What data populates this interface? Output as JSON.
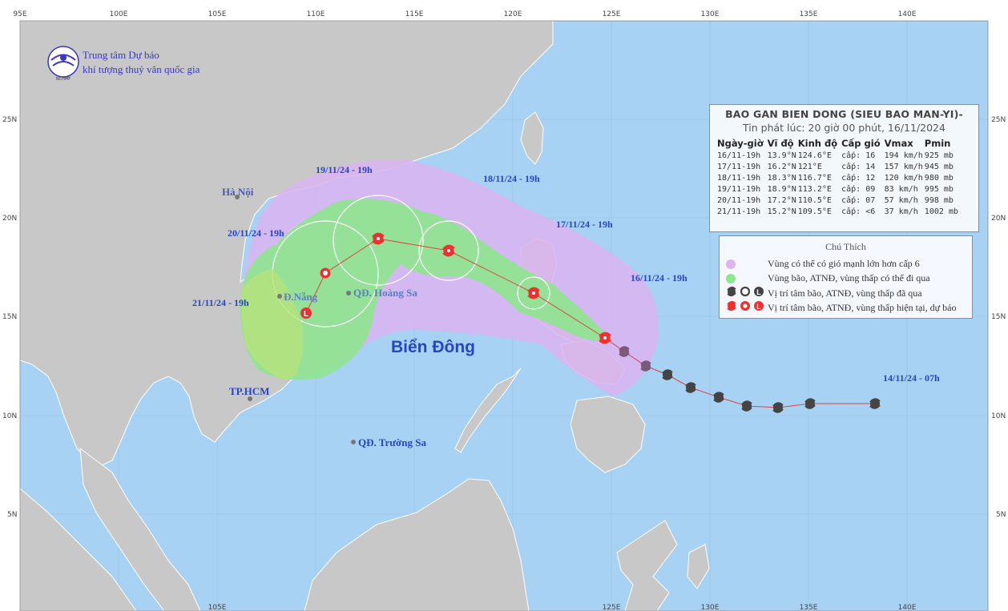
{
  "logo": {
    "line1": "Trung tâm Dự báo",
    "line2": "khí tượng thuỷ văn quốc gia",
    "emblem_text": "NCHMF"
  },
  "axes": {
    "top_lon_labels": [
      "95E",
      "100E",
      "105E",
      "110E",
      "115E",
      "120E",
      "125E",
      "130E",
      "135E",
      "140E"
    ],
    "bottom_lon_labels": [
      "105E",
      "125E",
      "130E",
      "135E",
      "140E"
    ],
    "lat_labels": [
      "25N",
      "20N",
      "15N",
      "10N",
      "5N"
    ]
  },
  "title_box": {
    "title": "BAO GAN BIEN DONG (SIEU BAO MAN-YI)-",
    "subtitle": "Tin phát lúc: 20 giờ 00 phút, 16/11/2024",
    "headers": [
      "Ngày-giờ",
      "Vĩ độ",
      "Kinh độ",
      "Cấp gió",
      "Vmax",
      "Pmin"
    ],
    "rows": [
      [
        "16/11-19h",
        "13.9°N",
        "124.6°E",
        "cấp: 16",
        "194 km/h",
        "925 mb"
      ],
      [
        "17/11-19h",
        "16.2°N",
        "121°E",
        "cấp: 14",
        "157 km/h",
        "945 mb"
      ],
      [
        "18/11-19h",
        "18.3°N",
        "116.7°E",
        "cấp: 12",
        "120 km/h",
        "980 mb"
      ],
      [
        "19/11-19h",
        "18.9°N",
        "113.2°E",
        "cấp: 09",
        "83 km/h",
        "995 mb"
      ],
      [
        "20/11-19h",
        "17.2°N",
        "110.5°E",
        "cấp: 07",
        "57 km/h",
        "998 mb"
      ],
      [
        "21/11-19h",
        "15.2°N",
        "109.5°E",
        "cấp: <6",
        "37 km/h",
        "1002 mb"
      ]
    ]
  },
  "legend": {
    "title": "Chú Thích",
    "items": [
      "Vùng có thể có gió mạnh lớn hơn cấp 6",
      "Vùng bão, ATNĐ, vùng thấp có thể đi qua",
      "Vị trí tâm bão, ATNĐ, vùng thấp đã qua",
      "Vị trí tâm bão, ATNĐ, vùng thấp hiện tại, dự báo"
    ],
    "colors": {
      "wind_zone": "#dbb4f0",
      "path_zone": "#8ee68e",
      "past": "#444444",
      "forecast": "#ee3030"
    }
  },
  "track_labels": [
    "19/11/24 - 19h",
    "18/11/24 - 19h",
    "17/11/24 - 19h",
    "16/11/24 - 19h",
    "20/11/24 - 19h",
    "21/11/24 - 19h",
    "14/11/24 - 07h"
  ],
  "places": {
    "hanoi": "Hà Nội",
    "danang": "Đ.Nẵng",
    "hoangsa": "QĐ. Hoàng Sa",
    "hcm": "TP.HCM",
    "truongsa": "QĐ. Trường Sa"
  },
  "sea_label": "Biển Đông"
}
